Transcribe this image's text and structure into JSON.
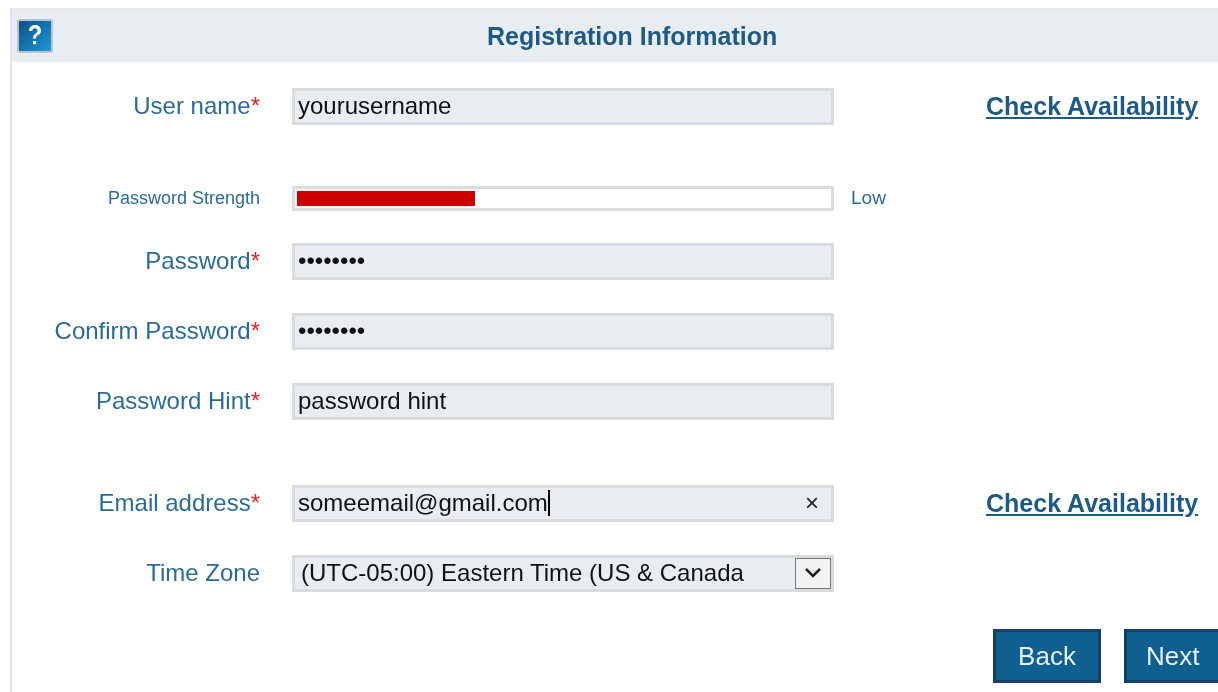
{
  "header": {
    "title": "Registration Information"
  },
  "rows": [
    {
      "kind": "text",
      "label": "User name",
      "required_mark": "*",
      "value": "yourusername",
      "link": "Check Availability"
    },
    {
      "kind": "strength",
      "label": "Password Strength",
      "level": 0.335,
      "reading": "Low"
    },
    {
      "kind": "text",
      "label": "Password",
      "required_mark": "*",
      "value": "••••••••"
    },
    {
      "kind": "text",
      "label": "Confirm Password",
      "required_mark": "*",
      "value": "••••••••"
    },
    {
      "kind": "text",
      "label": "Password Hint",
      "required_mark": "*",
      "value": "password hint"
    },
    {
      "kind": "email",
      "label": "Email address",
      "required_mark": "*",
      "value": "someemail@gmail.com",
      "clear": "×",
      "link": "Check Availability"
    },
    {
      "kind": "select",
      "label": "Time Zone",
      "value": "(UTC-05:00) Eastern Time (US & Canada"
    }
  ],
  "buttons": [
    "Back",
    "Next"
  ]
}
